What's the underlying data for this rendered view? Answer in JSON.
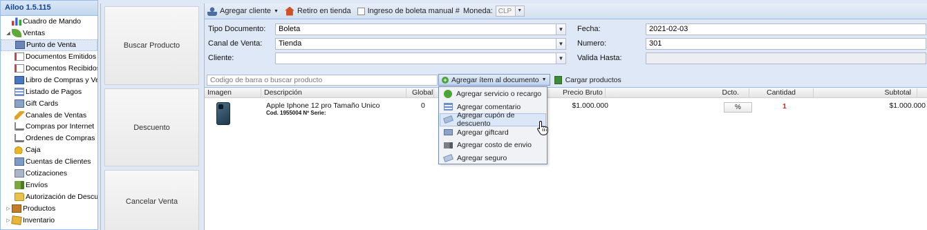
{
  "app": {
    "title": "Ailoo 1.5.115"
  },
  "sidebar": {
    "items": [
      {
        "label": "Cuadro de Mando",
        "icon": "chart-icon",
        "level": 0
      },
      {
        "label": "Ventas",
        "icon": "leaf-icon",
        "level": 0,
        "expanded": true
      },
      {
        "label": "Punto de Venta",
        "icon": "pos-icon",
        "level": 1,
        "selected": true
      },
      {
        "label": "Documentos Emitidos",
        "icon": "document-icon",
        "level": 1
      },
      {
        "label": "Documentos Recibidos",
        "icon": "document-icon",
        "level": 1
      },
      {
        "label": "Libro de Compras y Ventas",
        "icon": "book-icon",
        "level": 1
      },
      {
        "label": "Listado de Pagos",
        "icon": "list-icon",
        "level": 1
      },
      {
        "label": "Gift Cards",
        "icon": "gift-card-icon",
        "level": 1
      },
      {
        "label": "Canales de Ventas",
        "icon": "pencil-icon",
        "level": 1
      },
      {
        "label": "Compras por Internet",
        "icon": "cart-icon",
        "level": 1
      },
      {
        "label": "Ordenes de Compras",
        "icon": "cart-icon",
        "level": 1
      },
      {
        "label": "Caja",
        "icon": "coins-icon",
        "level": 1
      },
      {
        "label": "Cuentas de Clientes",
        "icon": "card-icon",
        "level": 1
      },
      {
        "label": "Cotizaciones",
        "icon": "quote-icon",
        "level": 1
      },
      {
        "label": "Envíos",
        "icon": "truck-icon",
        "level": 1
      },
      {
        "label": "Autorización de Descuentos",
        "icon": "folder-icon",
        "level": 1
      },
      {
        "label": "Productos",
        "icon": "products-icon",
        "level": 0
      },
      {
        "label": "Inventario",
        "icon": "box-icon",
        "level": 0
      }
    ]
  },
  "actions": {
    "buscar": "Buscar Producto",
    "descuento": "Descuento",
    "cancelar": "Cancelar Venta"
  },
  "toolbar": {
    "agregar_cliente": "Agregar cliente",
    "retiro": "Retiro en tienda",
    "ingreso_boleta": "Ingreso de boleta manual #",
    "moneda_label": "Moneda:",
    "moneda_value": "CLP"
  },
  "form": {
    "tipo_documento_label": "Tipo Documento:",
    "tipo_documento_value": "Boleta",
    "canal_label": "Canal de Venta:",
    "canal_value": "Tienda",
    "cliente_label": "Cliente:",
    "cliente_value": "",
    "fecha_label": "Fecha:",
    "fecha_value": "2021-02-03",
    "numero_label": "Numero:",
    "numero_value": "301",
    "valida_label": "Valida Hasta:",
    "valida_value": ""
  },
  "grid_toolbar": {
    "search_placeholder": "Codigo de barra o buscar producto",
    "agregar_item": "Agregar ítem al documento",
    "cargar": "Cargar productos"
  },
  "grid": {
    "columns": [
      "Imagen",
      "Descripción",
      "Global",
      "Precio Bruto",
      "Dcto.",
      "Cantidad",
      "Subtotal"
    ],
    "rows": [
      {
        "description": "Apple Iphone 12 pro Tamaño Unico",
        "sub": "Cod. 1955004 Nº Serie:",
        "global": "0",
        "precio": "$1.000.000",
        "dcto": "%",
        "cantidad": "1",
        "subtotal": "$1.000.000"
      }
    ]
  },
  "menu": {
    "items": [
      {
        "label": "Agregar servicio o recargo",
        "icon": "plus-icon"
      },
      {
        "label": "Agregar comentario",
        "icon": "comment-icon"
      },
      {
        "label": "Agregar cupón de descuento",
        "icon": "coupon-icon",
        "active": true
      },
      {
        "label": "Agregar giftcard",
        "icon": "giftcard-icon"
      },
      {
        "label": "Agregar costo de envio",
        "icon": "truck-icon"
      },
      {
        "label": "Agregar seguro",
        "icon": "insurance-icon"
      }
    ]
  }
}
